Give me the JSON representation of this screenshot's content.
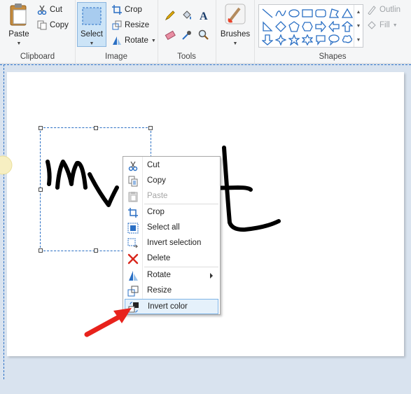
{
  "ribbon": {
    "clipboard": {
      "label": "Clipboard",
      "paste": "Paste",
      "cut": "Cut",
      "copy": "Copy"
    },
    "image": {
      "label": "Image",
      "select": "Select",
      "crop": "Crop",
      "resize": "Resize",
      "rotate": "Rotate"
    },
    "tools": {
      "label": "Tools"
    },
    "brushes": {
      "label": "Brushes"
    },
    "shapes": {
      "label": "Shapes",
      "outline": "Outlin",
      "fill": "Fill"
    }
  },
  "context_menu": {
    "items": [
      {
        "label": "Cut",
        "icon": "scissors-icon"
      },
      {
        "label": "Copy",
        "icon": "copy-icon"
      },
      {
        "label": "Paste",
        "icon": "paste-icon",
        "disabled": true
      },
      {
        "label": "Crop",
        "icon": "crop-icon"
      },
      {
        "label": "Select all",
        "icon": "select-all-icon"
      },
      {
        "label": "Invert selection",
        "icon": "invert-selection-icon"
      },
      {
        "label": "Delete",
        "icon": "delete-icon"
      },
      {
        "label": "Rotate",
        "icon": "rotate-icon",
        "submenu": true
      },
      {
        "label": "Resize",
        "icon": "resize-icon"
      },
      {
        "label": "Invert color",
        "icon": "invert-color-icon",
        "highlighted": true
      }
    ]
  },
  "colors": {
    "selection_fill": "#cce4f7",
    "highlight": "#e5f1fb",
    "arrow": "#e8221c",
    "accent": "#2a6fc4"
  }
}
